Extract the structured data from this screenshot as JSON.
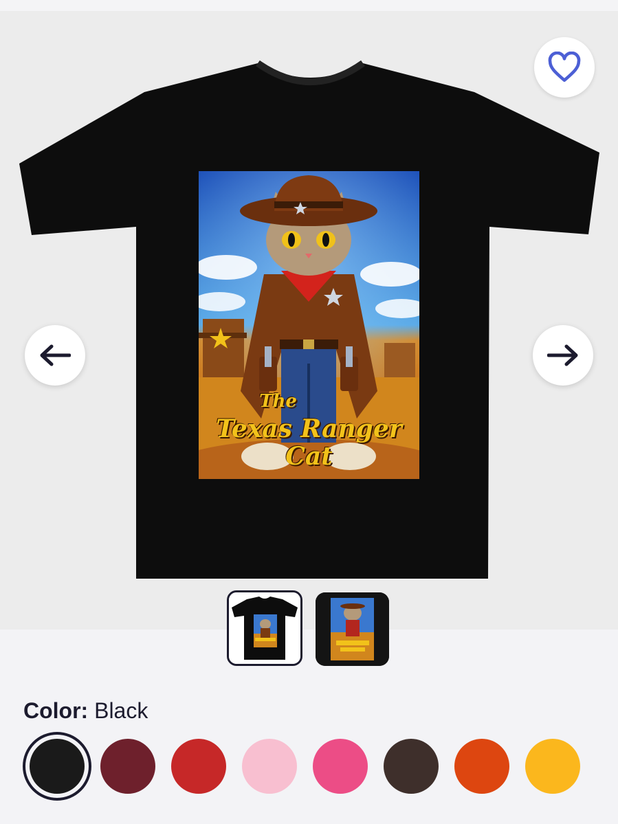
{
  "product": {
    "design_text_small": "The",
    "design_text_line1": "Texas Ranger",
    "design_text_line2": "Cat"
  },
  "actions": {
    "favorite_icon": "heart-outline-icon",
    "prev_icon": "arrow-left-icon",
    "next_icon": "arrow-right-icon"
  },
  "thumbnails": [
    {
      "label": "t-shirt-view",
      "selected": true
    },
    {
      "label": "design-view",
      "selected": false
    }
  ],
  "color": {
    "label": "Color:",
    "value": "Black",
    "options": [
      {
        "name": "Black",
        "hex": "#1a1a1a",
        "selected": true
      },
      {
        "name": "Maroon",
        "hex": "#6e202c"
      },
      {
        "name": "Red",
        "hex": "#c62828"
      },
      {
        "name": "Pink",
        "hex": "#f8bfd0"
      },
      {
        "name": "Hot Pink",
        "hex": "#ec4d86"
      },
      {
        "name": "Brown",
        "hex": "#3e2f2b"
      },
      {
        "name": "Orange",
        "hex": "#dd4610"
      },
      {
        "name": "Gold",
        "hex": "#fbb71d"
      }
    ]
  },
  "colors": {
    "accent": "#4c5fd5",
    "ink": "#1c1b2e"
  }
}
